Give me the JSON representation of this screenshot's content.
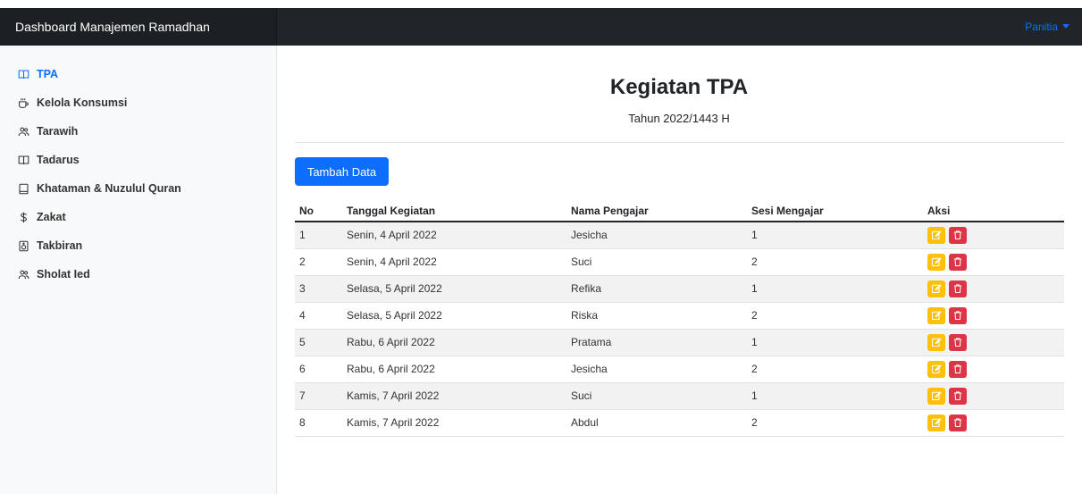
{
  "header": {
    "brand": "Dashboard Manajemen Ramadhan",
    "user_menu": "Panitia"
  },
  "sidebar": {
    "items": [
      {
        "label": "TPA",
        "icon": "book-open-icon",
        "active": true
      },
      {
        "label": "Kelola Konsumsi",
        "icon": "cup-icon",
        "active": false
      },
      {
        "label": "Tarawih",
        "icon": "people-icon",
        "active": false
      },
      {
        "label": "Tadarus",
        "icon": "book-open-icon",
        "active": false
      },
      {
        "label": "Khataman & Nuzulul Quran",
        "icon": "book-icon",
        "active": false
      },
      {
        "label": "Zakat",
        "icon": "dollar-icon",
        "active": false
      },
      {
        "label": "Takbiran",
        "icon": "speaker-icon",
        "active": false
      },
      {
        "label": "Sholat Ied",
        "icon": "people-icon",
        "active": false
      }
    ]
  },
  "main": {
    "title": "Kegiatan TPA",
    "subtitle": "Tahun 2022/1443 H",
    "add_button": "Tambah Data",
    "table": {
      "headers": [
        "No",
        "Tanggal Kegiatan",
        "Nama Pengajar",
        "Sesi Mengajar",
        "Aksi"
      ],
      "rows": [
        [
          "1",
          "Senin, 4 April 2022",
          "Jesicha",
          "1"
        ],
        [
          "2",
          "Senin, 4 April 2022",
          "Suci",
          "2"
        ],
        [
          "3",
          "Selasa, 5 April 2022",
          "Refika",
          "1"
        ],
        [
          "4",
          "Selasa, 5 April 2022",
          "Riska",
          "2"
        ],
        [
          "5",
          "Rabu, 6 April 2022",
          "Pratama",
          "1"
        ],
        [
          "6",
          "Rabu, 6 April 2022",
          "Jesicha",
          "2"
        ],
        [
          "7",
          "Kamis, 7 April 2022",
          "Suci",
          "1"
        ],
        [
          "8",
          "Kamis, 7 April 2022",
          "Abdul",
          "2"
        ]
      ]
    }
  },
  "colors": {
    "primary": "#0d6efd",
    "warning": "#ffc107",
    "danger": "#dc3545",
    "navbar": "#212529",
    "sidebar": "#f8f9fa"
  }
}
